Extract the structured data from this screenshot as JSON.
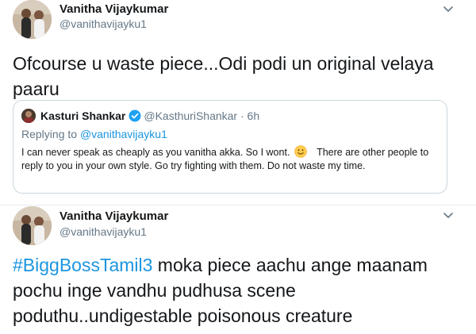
{
  "tweets": [
    {
      "author": {
        "name": "Vanitha Vijaykumar",
        "handle": "@vanithavijayku1"
      },
      "text_line1": "Ofcourse u waste piece...Odi podi un original velaya",
      "text_line2": "paaru",
      "quote": {
        "author": {
          "name": "Kasturi Shankar",
          "handle": "@KasthuriShankar",
          "dot": "·",
          "time": "6h"
        },
        "replying_prefix": "Replying to",
        "replying_handle": "@vanithavijayku1",
        "text_before_emoji": "I can never speak as cheaply  as you  vanitha akka.  So I wont.",
        "emoji": "slightly-smiling-face-icon",
        "text_after_emoji": "There are other people to reply to you in your own style. Go try fighting with them. Do not waste my time."
      }
    },
    {
      "author": {
        "name": "Vanitha Vijaykumar",
        "handle": "@vanithavijayku1"
      },
      "hashtag": "#BiggBossTamil3",
      "text_line1_rest": " moka piece aachu ange maanam",
      "text_line2": "pochu inge vandhu pudhusa scene",
      "text_line3": "poduthu..undigestable poisonous creature"
    }
  ],
  "colors": {
    "link": "#1b95e0",
    "secondary": "#657786",
    "border": "#ccd6dd",
    "verified": "#1da1f2"
  },
  "icons": {
    "menu": "chevron-down-icon",
    "verified": "verified-badge-icon"
  }
}
